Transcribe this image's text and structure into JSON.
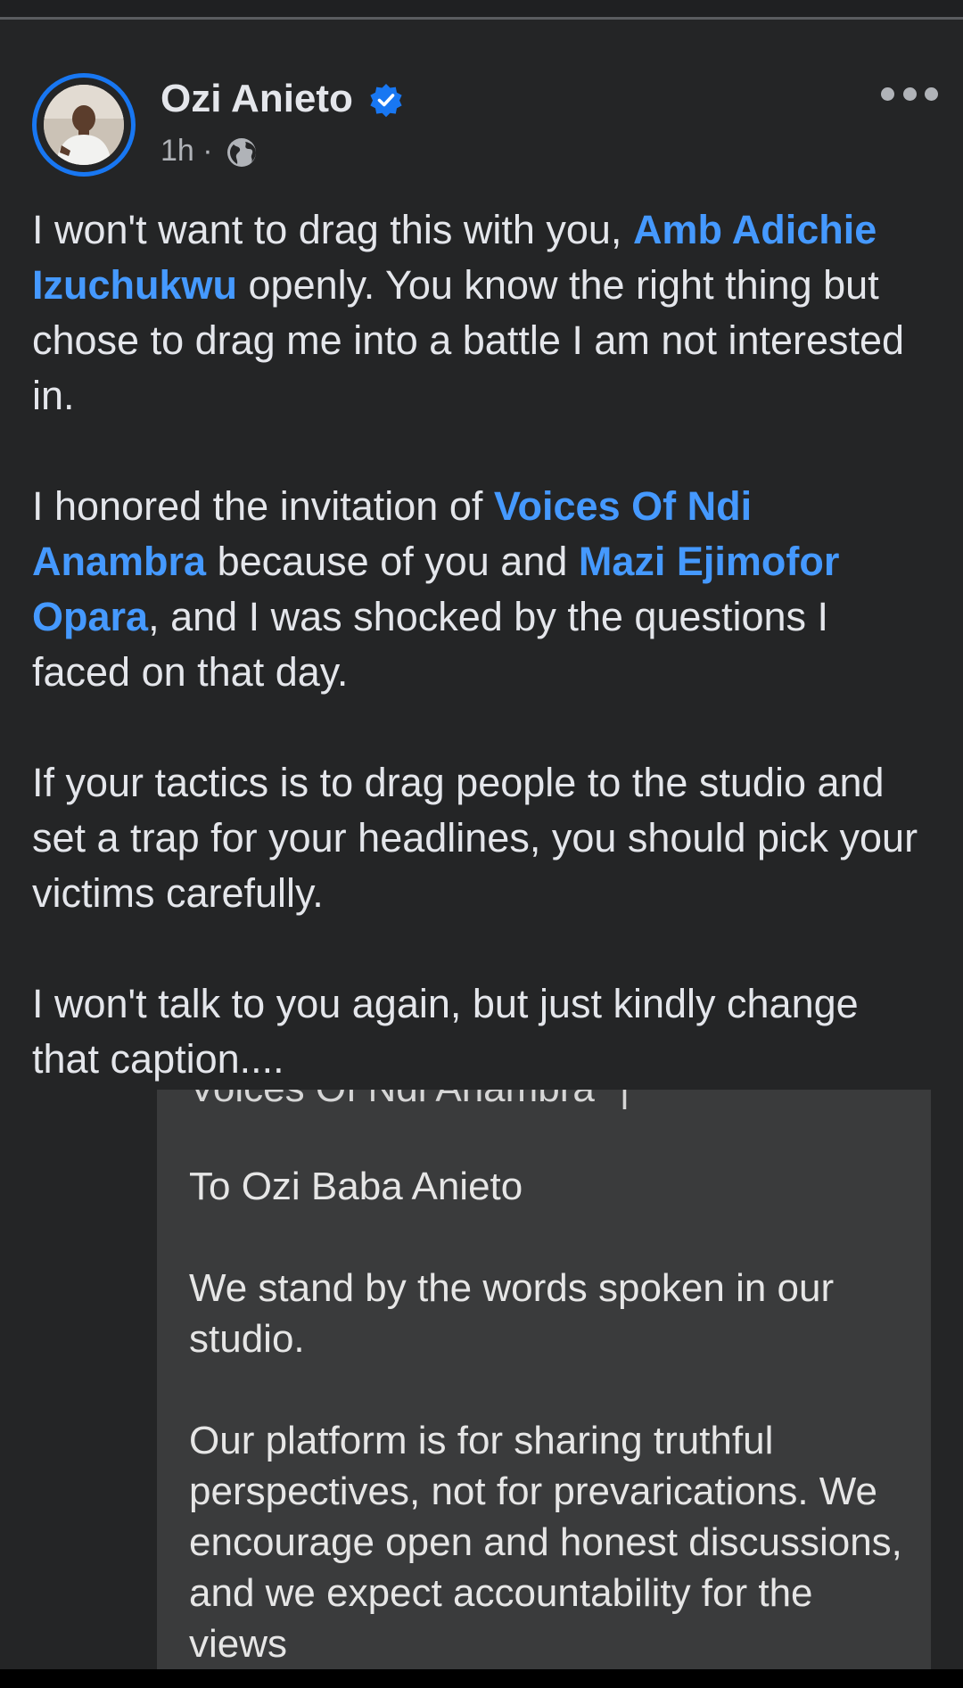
{
  "post": {
    "author": "Ozi Anieto",
    "time": "1h",
    "separator": "·",
    "paragraphs": [
      [
        {
          "text": "I won't want to drag this with you, ",
          "mention": false
        },
        {
          "text": "Amb Adichie Izuchukwu",
          "mention": true
        },
        {
          "text": " openly. You know the right thing but chose to drag me into a battle I am not interested in.",
          "mention": false
        }
      ],
      [
        {
          "text": "I honored the invitation of ",
          "mention": false
        },
        {
          "text": "Voices Of Ndi Anambra",
          "mention": true
        },
        {
          "text": " because of you and ",
          "mention": false
        },
        {
          "text": "Mazi Ejimofor Opara",
          "mention": true
        },
        {
          "text": ", and I was shocked by the questions I faced on that day.",
          "mention": false
        }
      ],
      [
        {
          "text": "If your tactics is to drag people to the studio and set a trap for your headlines, you should pick your victims carefully.",
          "mention": false
        }
      ],
      [
        {
          "text": "I won't talk to you again, but just kindly change that caption....",
          "mention": false
        }
      ]
    ]
  },
  "shared_image": {
    "cut_off_line": "Voices Of Ndi Anambra\" |",
    "paragraphs": [
      "To Ozi Baba Anieto",
      "We stand by the words spoken in our studio.",
      "Our platform is for sharing truthful perspectives, not for prevarications. We encourage open and honest discussions, and we expect accountability for the views"
    ]
  },
  "icons": {
    "verified": "verified-badge-icon",
    "audience": "globe-icon",
    "more": "more-options-icon"
  },
  "colors": {
    "background": "#242526",
    "mention": "#4599ff",
    "verified": "#1877f2",
    "secondary_text": "#b0b3b8"
  }
}
